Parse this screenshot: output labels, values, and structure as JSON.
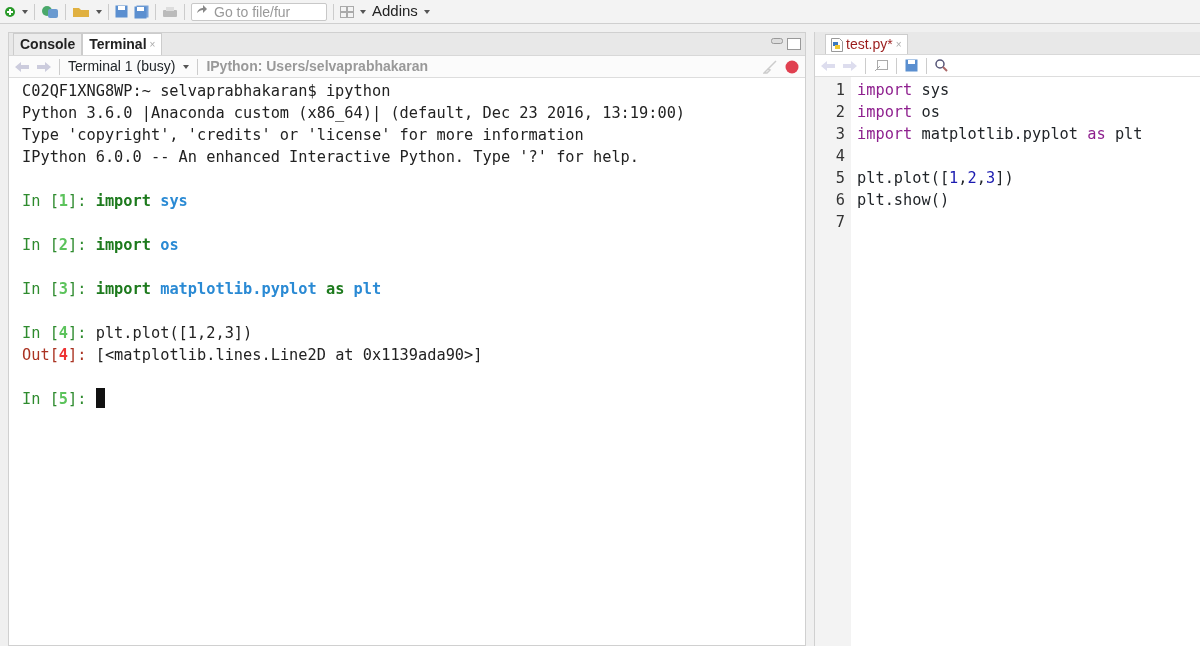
{
  "toolbar": {
    "search": {
      "placeholder": "Go to file/fur"
    },
    "addins": "Addins"
  },
  "console_pane": {
    "tabs": [
      {
        "label": "Console",
        "selected": false
      },
      {
        "label": "Terminal",
        "selected": true,
        "close": "×"
      }
    ],
    "terminal_select": "Terminal 1 (busy)",
    "terminal_title": "IPython: Users/selvaprabhakaran",
    "lines": [
      {
        "kind": "text",
        "segments": [
          {
            "kind": "plain",
            "text": "C02QF1XNG8WP:~ selvaprabhakaran$ ipython"
          }
        ]
      },
      {
        "kind": "text",
        "segments": [
          {
            "kind": "plain",
            "text": "Python 3.6.0 |Anaconda custom (x86_64)| (default, Dec 23 2016, 13:19:00)"
          }
        ]
      },
      {
        "kind": "text",
        "segments": [
          {
            "kind": "plain",
            "text": "Type 'copyright', 'credits' or 'license' for more information"
          }
        ]
      },
      {
        "kind": "text",
        "segments": [
          {
            "kind": "plain",
            "text": "IPython 6.0.0 -- An enhanced Interactive Python. Type '?' for help."
          }
        ]
      },
      {
        "kind": "blank"
      },
      {
        "kind": "text",
        "segments": [
          {
            "kind": "in",
            "text": "In ["
          },
          {
            "kind": "innum",
            "text": "1"
          },
          {
            "kind": "in",
            "text": "]: "
          },
          {
            "kind": "kw",
            "text": "import "
          },
          {
            "kind": "mod",
            "text": "sys"
          }
        ]
      },
      {
        "kind": "blank"
      },
      {
        "kind": "text",
        "segments": [
          {
            "kind": "in",
            "text": "In ["
          },
          {
            "kind": "innum",
            "text": "2"
          },
          {
            "kind": "in",
            "text": "]: "
          },
          {
            "kind": "kw",
            "text": "import "
          },
          {
            "kind": "mod",
            "text": "os"
          }
        ]
      },
      {
        "kind": "blank"
      },
      {
        "kind": "text",
        "segments": [
          {
            "kind": "in",
            "text": "In ["
          },
          {
            "kind": "innum",
            "text": "3"
          },
          {
            "kind": "in",
            "text": "]: "
          },
          {
            "kind": "kw",
            "text": "import "
          },
          {
            "kind": "mod",
            "text": "matplotlib.pyplot "
          },
          {
            "kind": "kw",
            "text": "as "
          },
          {
            "kind": "mod",
            "text": "plt"
          }
        ]
      },
      {
        "kind": "blank"
      },
      {
        "kind": "text",
        "segments": [
          {
            "kind": "in",
            "text": "In ["
          },
          {
            "kind": "innum",
            "text": "4"
          },
          {
            "kind": "in",
            "text": "]: "
          },
          {
            "kind": "plain",
            "text": "plt.plot([1,2,3])"
          }
        ]
      },
      {
        "kind": "text",
        "segments": [
          {
            "kind": "out",
            "text": "Out["
          },
          {
            "kind": "outnum",
            "text": "4"
          },
          {
            "kind": "out",
            "text": "]: "
          },
          {
            "kind": "plain",
            "text": "[<matplotlib.lines.Line2D at 0x1139ada90>]"
          }
        ]
      },
      {
        "kind": "blank"
      },
      {
        "kind": "text",
        "segments": [
          {
            "kind": "in",
            "text": "In ["
          },
          {
            "kind": "innum",
            "text": "5"
          },
          {
            "kind": "in",
            "text": "]: "
          },
          {
            "kind": "cursor"
          }
        ]
      }
    ]
  },
  "editor_pane": {
    "tab": {
      "label": "test.py*",
      "selected": true,
      "close": "×"
    },
    "lines": [
      {
        "number": "1",
        "tokens": [
          {
            "kind": "kw",
            "text": "import"
          },
          {
            "kind": "plain",
            "text": " sys"
          }
        ]
      },
      {
        "number": "2",
        "tokens": [
          {
            "kind": "kw",
            "text": "import"
          },
          {
            "kind": "plain",
            "text": " os"
          }
        ]
      },
      {
        "number": "3",
        "tokens": [
          {
            "kind": "kw",
            "text": "import"
          },
          {
            "kind": "plain",
            "text": " matplotlib.pyplot "
          },
          {
            "kind": "kw",
            "text": "as"
          },
          {
            "kind": "plain",
            "text": " plt"
          }
        ]
      },
      {
        "number": "4"
      },
      {
        "number": "5",
        "tokens": [
          {
            "kind": "plain",
            "text": "plt.plot(["
          },
          {
            "kind": "num",
            "text": "1"
          },
          {
            "kind": "plain",
            "text": ","
          },
          {
            "kind": "num",
            "text": "2"
          },
          {
            "kind": "plain",
            "text": ","
          },
          {
            "kind": "num",
            "text": "3"
          },
          {
            "kind": "plain",
            "text": "])"
          }
        ]
      },
      {
        "number": "6",
        "tokens": [
          {
            "kind": "plain",
            "text": "plt.show()"
          }
        ]
      },
      {
        "number": "7"
      }
    ]
  }
}
